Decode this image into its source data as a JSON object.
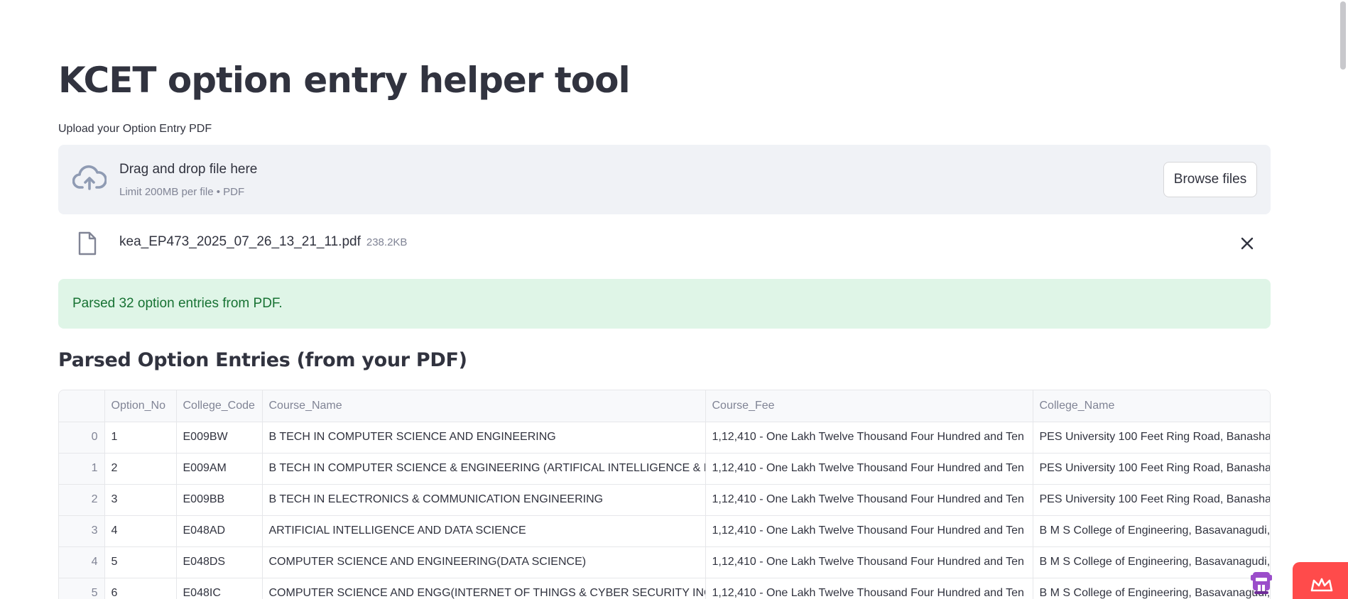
{
  "page": {
    "title": "KCET option entry helper tool"
  },
  "uploader": {
    "label": "Upload your Option Entry PDF",
    "drop_title": "Drag and drop file here",
    "drop_subtitle": "Limit 200MB per file • PDF",
    "browse_label": "Browse files",
    "icon": "cloud-upload-icon"
  },
  "uploaded_file": {
    "name": "kea_EP473_2025_07_26_13_21_11.pdf",
    "size": "238.2KB",
    "icon": "file-icon"
  },
  "status": {
    "message": "Parsed 32 option entries from PDF.",
    "color": "#177233",
    "background": "#dff5e7"
  },
  "table": {
    "title": "Parsed Option Entries (from your PDF)",
    "columns": [
      "",
      "Option_No",
      "College_Code",
      "Course_Name",
      "Course_Fee",
      "College_Name"
    ],
    "rows": [
      [
        "0",
        "1",
        "E009BW",
        "B TECH IN COMPUTER SCIENCE AND ENGINEERING",
        "1,12,410 - One Lakh Twelve Thousand Four Hundred and Ten",
        "PES University 100 Feet Ring Road, Banasha"
      ],
      [
        "1",
        "2",
        "E009AM",
        "B TECH IN COMPUTER SCIENCE & ENGINEERING (ARTIFICAL INTELLIGENCE & MACHIN",
        "1,12,410 - One Lakh Twelve Thousand Four Hundred and Ten",
        "PES University 100 Feet Ring Road, Banasha"
      ],
      [
        "2",
        "3",
        "E009BB",
        "B TECH IN ELECTRONICS & COMMUNICATION ENGINEERING",
        "1,12,410 - One Lakh Twelve Thousand Four Hundred and Ten",
        "PES University 100 Feet Ring Road, Banasha"
      ],
      [
        "3",
        "4",
        "E048AD",
        "ARTIFICIAL INTELLIGENCE AND DATA SCIENCE",
        "1,12,410 - One Lakh Twelve Thousand Four Hundred and Ten",
        "B M S College of Engineering, Basavanagudi,"
      ],
      [
        "4",
        "5",
        "E048DS",
        "COMPUTER SCIENCE AND ENGINEERING(DATA SCIENCE)",
        "1,12,410 - One Lakh Twelve Thousand Four Hundred and Ten",
        "B M S College of Engineering, Basavanagudi,"
      ],
      [
        "5",
        "6",
        "E048IC",
        "COMPUTER SCIENCE AND ENGG(INTERNET OF THINGS & CYBER SECURITY INCLUDING",
        "1,12,410 - One Lakh Twelve Thousand Four Hundred and Ten",
        "B M S College of Engineering, Basavanagudi,"
      ]
    ]
  },
  "colors": {
    "accent": "#ff4b4b",
    "text": "#31333f",
    "muted": "#808495"
  }
}
